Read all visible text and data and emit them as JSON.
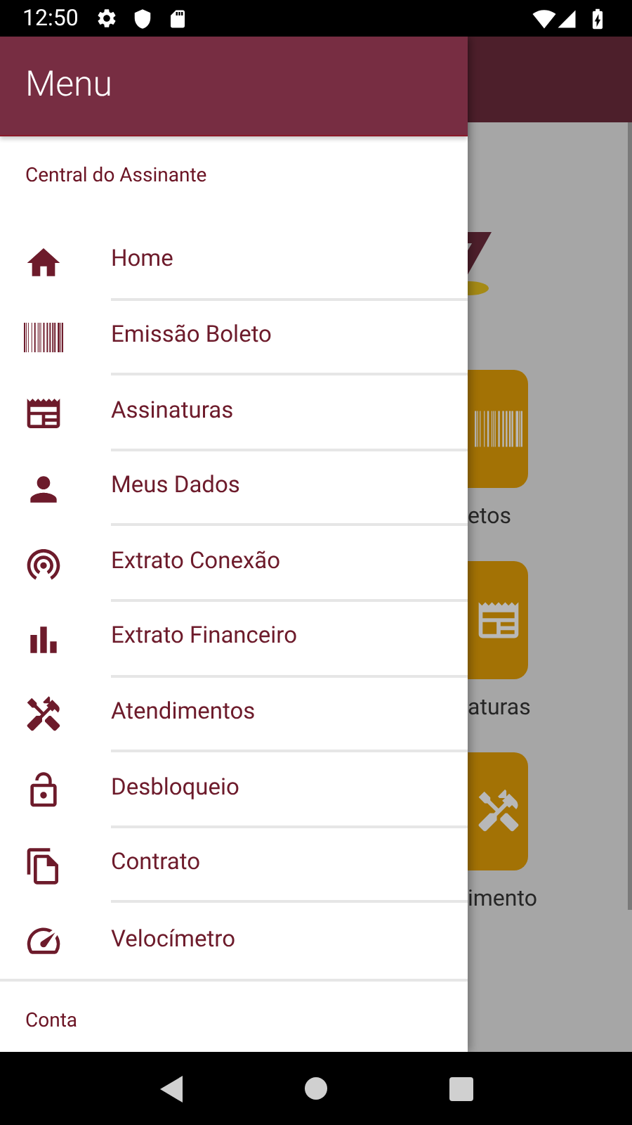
{
  "status_bar": {
    "time": "12:50"
  },
  "background": {
    "tiles": [
      {
        "label": "etos"
      },
      {
        "label": "aturas"
      },
      {
        "label": "imento"
      }
    ]
  },
  "drawer": {
    "title": "Menu",
    "section": "Central do Assinante",
    "items": [
      {
        "label": "Home"
      },
      {
        "label": "Emissão Boleto"
      },
      {
        "label": "Assinaturas"
      },
      {
        "label": "Meus Dados"
      },
      {
        "label": "Extrato Conexão"
      },
      {
        "label": "Extrato Financeiro"
      },
      {
        "label": "Atendimentos"
      },
      {
        "label": "Desbloqueio"
      },
      {
        "label": "Contrato"
      },
      {
        "label": "Velocímetro"
      }
    ],
    "footer": "Conta"
  }
}
